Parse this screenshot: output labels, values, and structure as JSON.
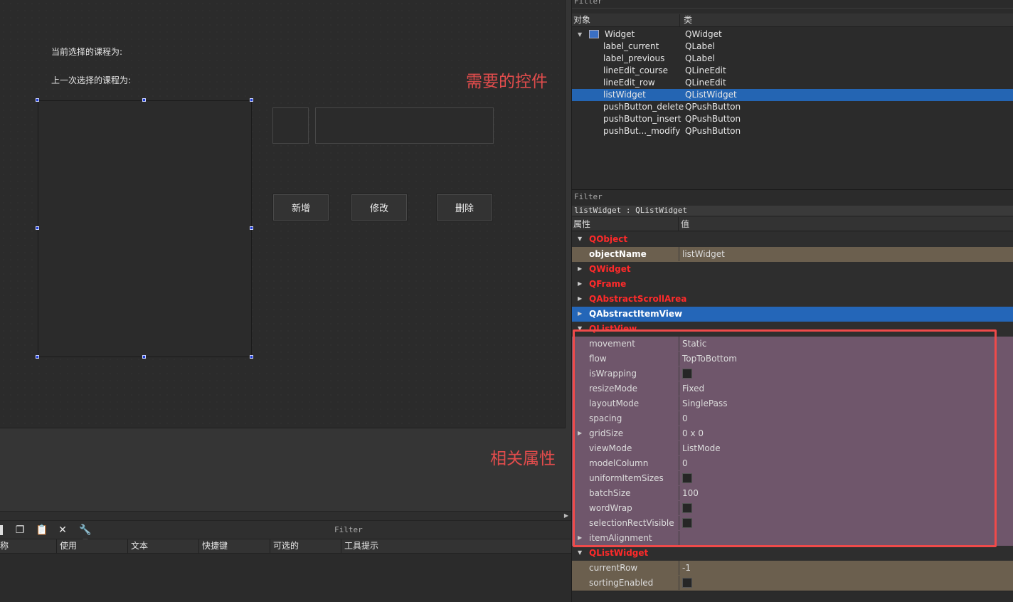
{
  "designer": {
    "label_current": "当前选择的课程为:",
    "label_previous": "上一次选择的课程为:",
    "buttons": {
      "insert": "新增",
      "modify": "修改",
      "delete": "删除"
    }
  },
  "annotations": {
    "widgets": "需要的控件",
    "properties": "相关属性"
  },
  "action_editor": {
    "filter": "Filter",
    "columns": [
      "称",
      "使用",
      "文本",
      "快捷键",
      "可选的",
      "工具提示"
    ]
  },
  "object_inspector": {
    "filter": "Filter",
    "headers": {
      "object": "对象",
      "class": "类"
    },
    "root": {
      "name": "Widget",
      "class": "QWidget"
    },
    "items": [
      {
        "name": "label_current",
        "class": "QLabel"
      },
      {
        "name": "label_previous",
        "class": "QLabel"
      },
      {
        "name": "lineEdit_course",
        "class": "QLineEdit"
      },
      {
        "name": "lineEdit_row",
        "class": "QLineEdit"
      },
      {
        "name": "listWidget",
        "class": "QListWidget"
      },
      {
        "name": "pushButton_delete",
        "class": "QPushButton"
      },
      {
        "name": "pushButton_insert",
        "class": "QPushButton"
      },
      {
        "name": "pushBut..._modify",
        "class": "QPushButton"
      }
    ],
    "selected_index": 4
  },
  "property_editor": {
    "filter": "Filter",
    "context": "listWidget : QListWidget",
    "headers": {
      "property": "属性",
      "value": "值"
    },
    "groups": {
      "qobject": "QObject",
      "qwidget": "QWidget",
      "qframe": "QFrame",
      "qabstractscrollarea": "QAbstractScrollArea",
      "qabstractitemview": "QAbstractItemView",
      "qlistview": "QListView",
      "qlistwidget": "QListWidget"
    },
    "objectName": {
      "name": "objectName",
      "value": "listWidget"
    },
    "listview_props": [
      {
        "name": "movement",
        "value": "Static"
      },
      {
        "name": "flow",
        "value": "TopToBottom"
      },
      {
        "name": "isWrapping",
        "value": "",
        "checkbox": true
      },
      {
        "name": "resizeMode",
        "value": "Fixed"
      },
      {
        "name": "layoutMode",
        "value": "SinglePass"
      },
      {
        "name": "spacing",
        "value": "0"
      },
      {
        "name": "gridSize",
        "value": "0 x 0",
        "expandable": true
      },
      {
        "name": "viewMode",
        "value": "ListMode"
      },
      {
        "name": "modelColumn",
        "value": "0"
      },
      {
        "name": "uniformItemSizes",
        "value": "",
        "checkbox": true
      },
      {
        "name": "batchSize",
        "value": "100"
      },
      {
        "name": "wordWrap",
        "value": "",
        "checkbox": true
      },
      {
        "name": "selectionRectVisible",
        "value": "",
        "checkbox": true
      },
      {
        "name": "itemAlignment",
        "value": "",
        "expandable": true
      }
    ],
    "listwidget_props": [
      {
        "name": "currentRow",
        "value": "-1"
      },
      {
        "name": "sortingEnabled",
        "value": "",
        "checkbox": true
      }
    ]
  },
  "colors": {
    "selection": "#2465b3",
    "annotation": "#e14c4c",
    "group_red": "#ff2a2a"
  }
}
